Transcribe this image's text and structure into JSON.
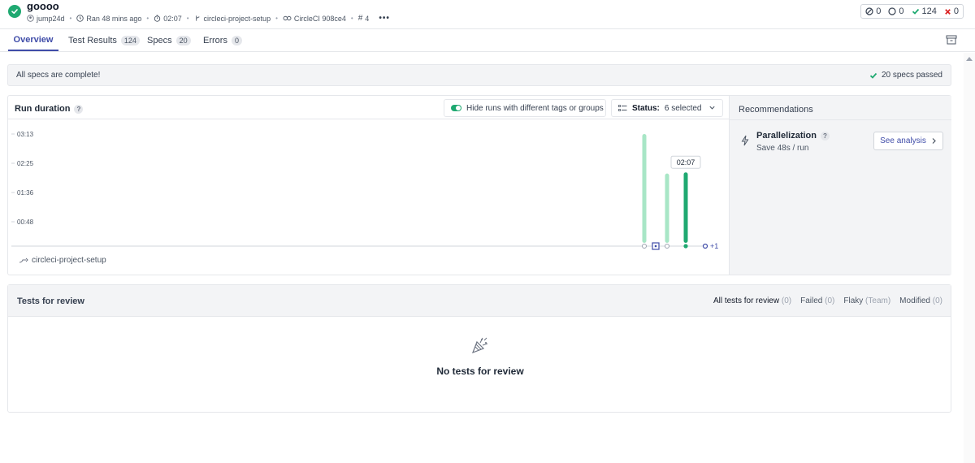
{
  "header": {
    "title": "goooo",
    "author": "jump24d",
    "ran": "Ran 48 mins ago",
    "duration": "02:07",
    "branch": "circleci-project-setup",
    "ci": "CircleCI 908ce4",
    "run_number": "4",
    "more": "•••",
    "counts": {
      "skipped": "0",
      "pending": "0",
      "passed": "124",
      "failed": "0"
    }
  },
  "tabs": [
    {
      "label": "Overview",
      "badge": ""
    },
    {
      "label": "Test Results",
      "badge": "124"
    },
    {
      "label": "Specs",
      "badge": "20"
    },
    {
      "label": "Errors",
      "badge": "0"
    }
  ],
  "banner": {
    "left": "All specs are complete!",
    "right": "20 specs passed"
  },
  "run_duration": {
    "title": "Run duration",
    "help": "?",
    "toggle_label": "Hide runs with different tags or groups",
    "status_label": "Status:",
    "status_value": "6 selected",
    "branch": "circleci-project-setup",
    "overflow": "+1"
  },
  "chart_data": {
    "type": "bar",
    "y_ticks": [
      "03:13",
      "02:25",
      "01:36",
      "00:48"
    ],
    "ylim": [
      0,
      193
    ],
    "values": [
      193,
      0,
      0,
      0,
      125,
      0,
      127
    ],
    "tooltip": "02:07",
    "colors": {
      "bar": "#a8e6c6",
      "selected": "#1fa971",
      "axis": "#d1d5db",
      "marker": "#3f4ca8"
    }
  },
  "recommendations": {
    "title": "Recommendations",
    "item_title": "Parallelization",
    "item_sub": "Save 48s / run",
    "button": "See analysis"
  },
  "review": {
    "title": "Tests for review",
    "filters": [
      {
        "label": "All tests for review",
        "count": "(0)"
      },
      {
        "label": "Failed",
        "count": "(0)"
      },
      {
        "label": "Flaky",
        "count": "(Team)"
      },
      {
        "label": "Modified",
        "count": "(0)"
      }
    ],
    "empty": "No tests for review"
  }
}
